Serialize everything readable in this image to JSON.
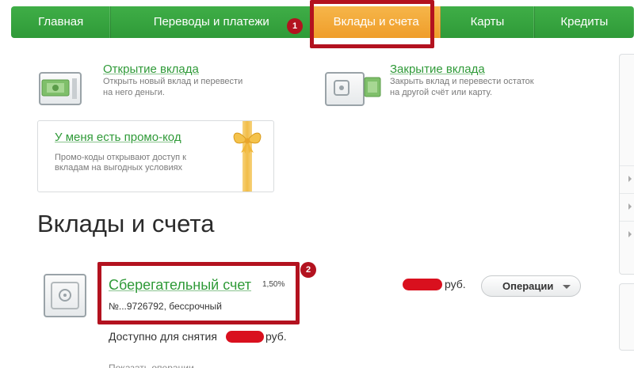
{
  "nav": {
    "items": [
      {
        "label": "Главная"
      },
      {
        "label": "Переводы и платежи"
      },
      {
        "label": "Вклады и счета"
      },
      {
        "label": "Карты"
      },
      {
        "label": "Кредиты"
      }
    ],
    "active_index": 2
  },
  "annotations": {
    "badge1": "1",
    "badge2": "2"
  },
  "actions": {
    "open": {
      "title": "Открытие вклада",
      "desc_line1": "Открыть новый вклад и перевести",
      "desc_line2": "на него деньги."
    },
    "close": {
      "title": "Закрытие вклада",
      "desc_line1": "Закрыть вклад и перевести остаток",
      "desc_line2": "на другой счёт или карту."
    }
  },
  "promo": {
    "title": "У меня есть промо-код",
    "desc_line1": "Промо-коды открывают доступ к",
    "desc_line2": "вкладам на выгодных условиях"
  },
  "section": {
    "title": "Вклады и счета"
  },
  "account": {
    "name": "Сберегательный счет",
    "rate": "1,50%",
    "number": "№...9726792, бессрочный",
    "balance_currency": "руб.",
    "available_label": "Доступно для снятия",
    "available_currency": "руб.",
    "operations_label": "Операции",
    "truncated_link": "Показать операции"
  },
  "colors": {
    "nav_green": "#2f9a38",
    "nav_active": "#ef9d2a",
    "highlight_red": "#b3121f",
    "link_green": "#2f9a38"
  }
}
